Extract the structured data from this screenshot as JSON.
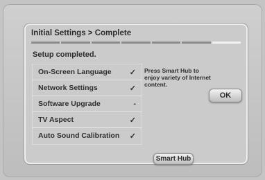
{
  "dialog": {
    "title": "Initial Settings > Complete",
    "progress": {
      "total_steps": 7,
      "current_step": 7
    },
    "status": "Setup completed.",
    "items": [
      {
        "label": "On-Screen Language",
        "mark": "✓"
      },
      {
        "label": "Network Settings",
        "mark": "✓"
      },
      {
        "label": "Software Upgrade",
        "mark": "-"
      },
      {
        "label": "TV Aspect",
        "mark": "✓"
      },
      {
        "label": "Auto Sound Calibration",
        "mark": "✓"
      }
    ],
    "info_text": "Press Smart Hub to enjoy variety of Internet content.",
    "ok_label": "OK",
    "smart_hub_label": "Smart Hub"
  }
}
